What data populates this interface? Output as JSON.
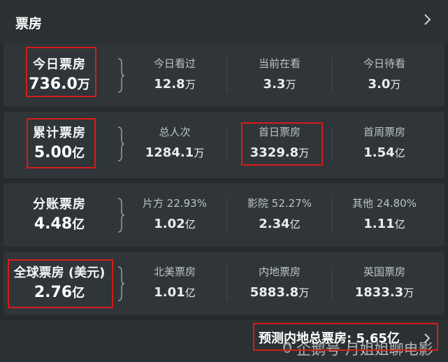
{
  "header": {
    "title": "票房"
  },
  "rows": [
    {
      "title": "今日票房",
      "value": "736.0",
      "unit": "万",
      "cells": [
        {
          "label": "今日看过",
          "value": "12.8",
          "unit": "万"
        },
        {
          "label": "当前在看",
          "value": "3.3",
          "unit": "万"
        },
        {
          "label": "今日待看",
          "value": "3.0",
          "unit": "万"
        }
      ]
    },
    {
      "title": "累计票房",
      "value": "5.00",
      "unit": "亿",
      "cells": [
        {
          "label": "总人次",
          "value": "1284.1",
          "unit": "万"
        },
        {
          "label": "首日票房",
          "value": "3329.8",
          "unit": "万"
        },
        {
          "label": "首周票房",
          "value": "1.54",
          "unit": "亿"
        }
      ]
    },
    {
      "title": "分账票房",
      "value": "4.48",
      "unit": "亿",
      "cells": [
        {
          "label": "片方 22.93%",
          "value": "1.02",
          "unit": "亿"
        },
        {
          "label": "影院 52.27%",
          "value": "2.34",
          "unit": "亿"
        },
        {
          "label": "其他 24.80%",
          "value": "1.11",
          "unit": "亿"
        }
      ]
    },
    {
      "title": "全球票房 (美元)",
      "value": "2.76",
      "unit": "亿",
      "cells": [
        {
          "label": "北美票房",
          "value": "1.01",
          "unit": "亿"
        },
        {
          "label": "内地票房",
          "value": "5883.8",
          "unit": "万"
        },
        {
          "label": "英国票房",
          "value": "1833.3",
          "unit": "万"
        }
      ]
    }
  ],
  "footer": {
    "forecast_label": "预测内地总票房:",
    "forecast_value": "5.65",
    "forecast_unit": "亿"
  },
  "watermark": {
    "text": "企鹅号 月姐姐聊电影"
  },
  "colors": {
    "highlight": "#d81b1b",
    "background": "#262b2d",
    "panel": "#2f3538"
  }
}
